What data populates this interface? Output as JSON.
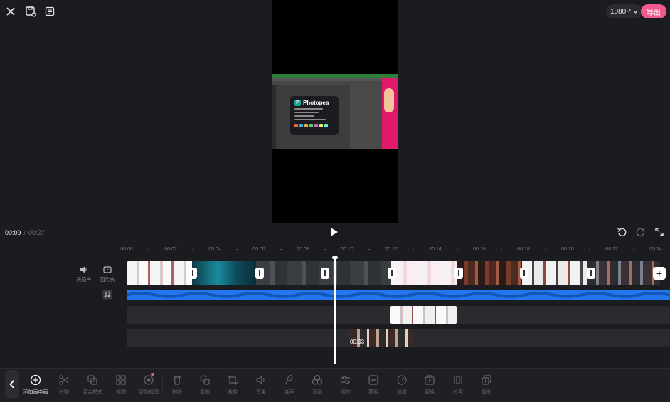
{
  "topbar": {
    "resolution": "1080P",
    "export_label": "导出"
  },
  "preview": {
    "app_name": "Photopea"
  },
  "playback": {
    "current_time": "00:09",
    "separator": "/",
    "total_time": "00:27"
  },
  "ruler": [
    "00:00",
    "00:02",
    "00:04",
    "00:06",
    "00:08",
    "00:10",
    "00:12",
    "00:14",
    "00:16",
    "00:18",
    "00:20",
    "00:22",
    "00:24"
  ],
  "side": {
    "mute_label": "关原声",
    "cover_label": "加片头"
  },
  "overlay": {
    "clip_time": "00:03"
  },
  "toolbar": {
    "add_pip": "添加画中画",
    "items": [
      "分割",
      "混合模式",
      "抠图",
      "智能抠图",
      "删除",
      "复制",
      "裁剪",
      "音量",
      "变声",
      "动画",
      "调节",
      "蒙版",
      "速度",
      "替换",
      "分离",
      "复制"
    ]
  },
  "colors": {
    "accent": "#f05a8c",
    "audio": "#2277ee",
    "background": "#1b1c1f"
  }
}
